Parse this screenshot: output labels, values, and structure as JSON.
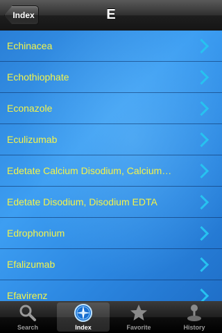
{
  "navbar": {
    "back_label": "Index",
    "title": "E"
  },
  "list": {
    "items": [
      {
        "label": "Echinacea"
      },
      {
        "label": "Echothiophate"
      },
      {
        "label": "Econazole"
      },
      {
        "label": "Eculizumab"
      },
      {
        "label": "Edetate Calcium Disodium, Calcium…"
      },
      {
        "label": "Edetate Disodium, Disodium EDTA"
      },
      {
        "label": "Edrophonium"
      },
      {
        "label": "Efalizumab"
      },
      {
        "label": "Efavirenz"
      }
    ]
  },
  "tabbar": {
    "tabs": [
      {
        "label": "Search",
        "icon": "search-icon"
      },
      {
        "label": "Index",
        "icon": "compass-icon"
      },
      {
        "label": "Favorite",
        "icon": "star-icon"
      },
      {
        "label": "History",
        "icon": "joystick-icon"
      }
    ],
    "active": "Index"
  },
  "colors": {
    "item_text": "#f4f44a",
    "chevron": "#27c2f0"
  }
}
